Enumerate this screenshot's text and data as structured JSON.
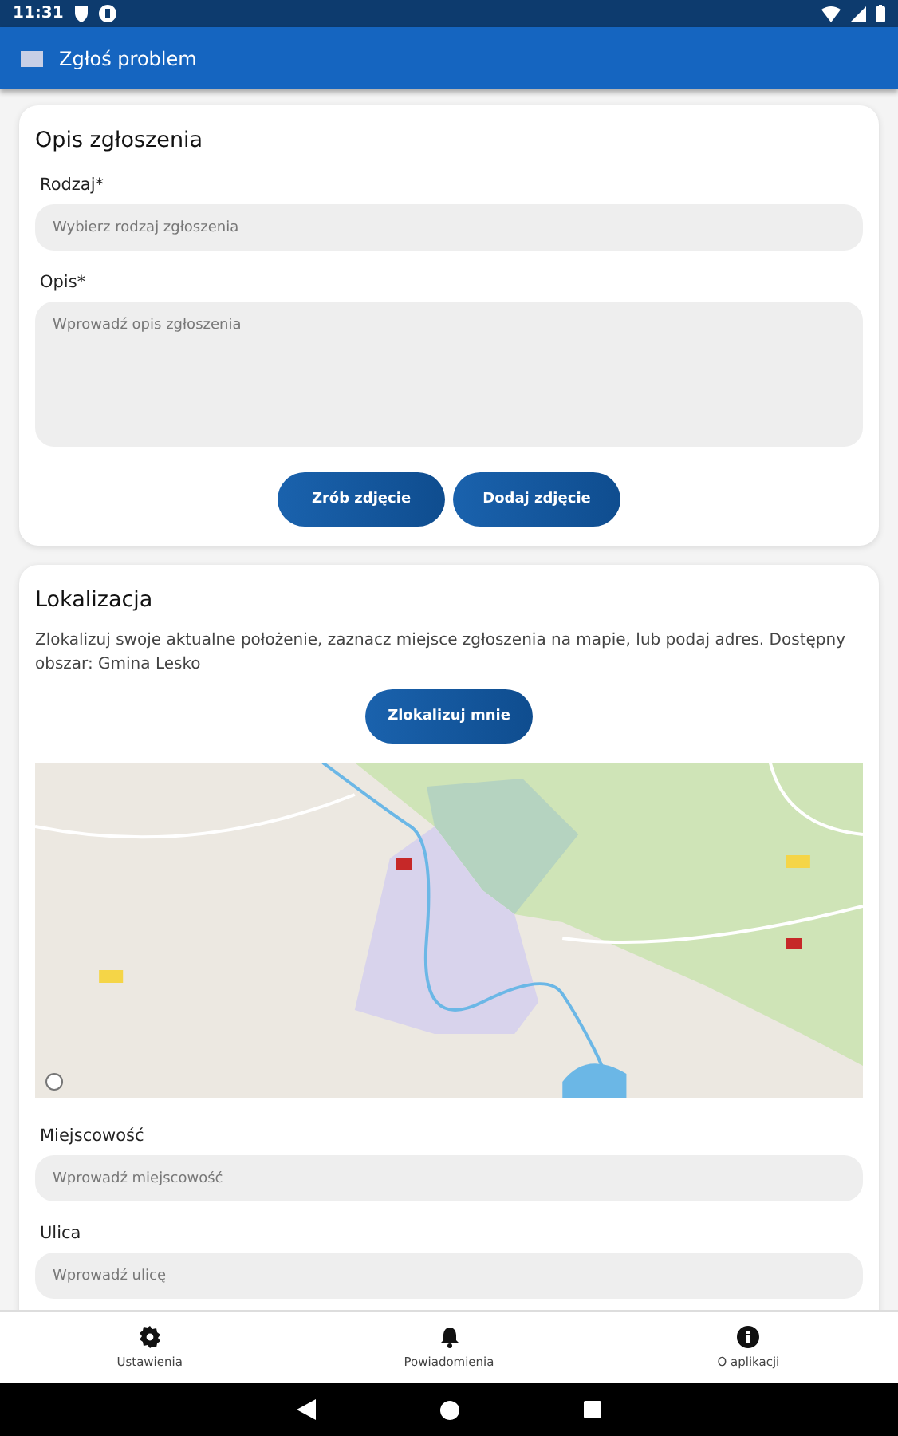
{
  "status_bar": {
    "time": "11:31"
  },
  "app_bar": {
    "title": "Zgłoś problem"
  },
  "description_card": {
    "title": "Opis zgłoszenia",
    "fields": [
      {
        "kind": "select",
        "label": "Rodzaj*",
        "placeholder": "Wybierz rodzaj zgłoszenia"
      },
      {
        "kind": "textarea",
        "label": "Opis*",
        "placeholder": "Wprowadź opis zgłoszenia"
      }
    ],
    "buttons": [
      "Zrób zdjęcie",
      "Dodaj zdjęcie"
    ]
  },
  "location_card": {
    "title": "Lokalizacja",
    "text": "Zlokalizuj swoje aktualne położenie, zaznacz miejsce zgłoszenia na mapie, lub podaj adres. Dostępny obszar: Gmina Lesko",
    "button": "Zlokalizuj mnie",
    "fields": [
      {
        "label": "Miejscowość",
        "placeholder": "Wprowadź miejscowość"
      },
      {
        "label": "Ulica",
        "placeholder": "Wprowadź ulicę"
      }
    ]
  },
  "bottom_nav": [
    {
      "kind": "settings",
      "label": "Ustawienia"
    },
    {
      "kind": "bell",
      "label": "Powiadomienia"
    },
    {
      "kind": "info",
      "label": "O aplikacji"
    }
  ]
}
